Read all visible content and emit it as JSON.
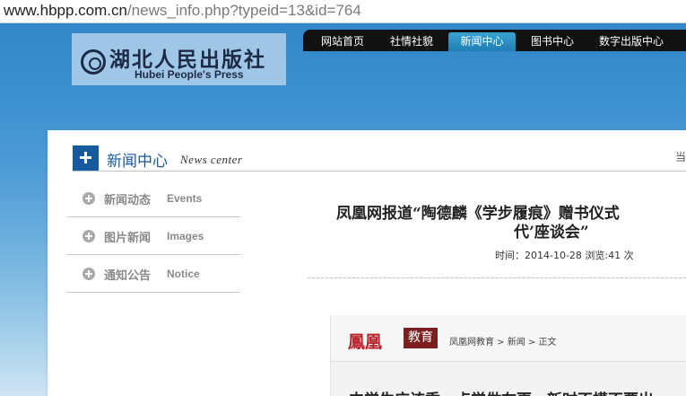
{
  "browser": {
    "url_host": "www.hbpp.com.cn",
    "url_path": "/news_info.php?typeid=13&id=764"
  },
  "header": {
    "logo_cn": "湖北人民出版社",
    "logo_en": "Hubei People's Press",
    "nav": [
      {
        "label": "网站首页",
        "active": false
      },
      {
        "label": "社情社貌",
        "active": false
      },
      {
        "label": "新闻中心",
        "active": true
      },
      {
        "label": "图书中心",
        "active": false
      },
      {
        "label": "数字出版中心",
        "active": false
      }
    ]
  },
  "section": {
    "title_cn": "新闻中心",
    "title_en": "News center",
    "breadcrumb_edge": "当"
  },
  "sidebar": {
    "items": [
      {
        "label_cn": "新闻动态",
        "label_en": "Events"
      },
      {
        "label_cn": "图片新闻",
        "label_en": "Images"
      },
      {
        "label_cn": "通知公告",
        "label_en": "Notice"
      }
    ]
  },
  "article": {
    "title_line1": "凤凰网报道“陶德麟《学步履痕》赠书仪式",
    "title_line2": "代’座谈会”",
    "meta": "时间：2014-10-28   浏览:41 次"
  },
  "embed": {
    "logo": "鳳凰",
    "tag": "教育",
    "breadcrumb": "凤凰网教育 > 新闻 > 正文",
    "headline": "中学生应该乘一点学做在更，新时不模不要出"
  },
  "colors": {
    "nav_bg": "#111111",
    "nav_active": "#1e7fb4",
    "accent_blue": "#17599e",
    "sidebar_text": "#8a8a8a",
    "ifeng_red": "#b8202a"
  }
}
